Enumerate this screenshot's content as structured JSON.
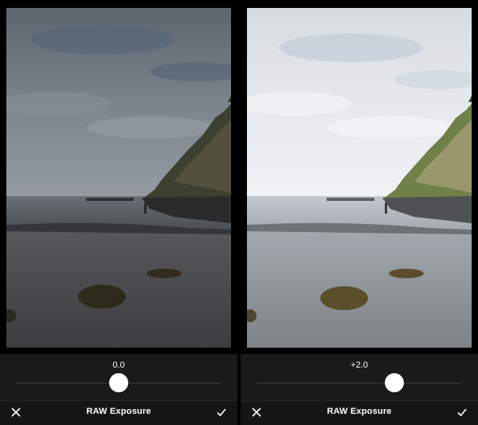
{
  "panels": [
    {
      "exposure_value": "0.0",
      "exposure_fraction": 0.5,
      "tool_title": "RAW Exposure",
      "cancel_icon": "close-icon",
      "confirm_icon": "checkmark-icon",
      "brightness": "dark"
    },
    {
      "exposure_value": "+2.0",
      "exposure_fraction": 0.67,
      "tool_title": "RAW Exposure",
      "cancel_icon": "close-icon",
      "confirm_icon": "checkmark-icon",
      "brightness": "bright"
    }
  ],
  "colors": {
    "background": "#000000",
    "control_bar": "#1a1a1a",
    "text": "#ffffff",
    "thumb": "#ffffff"
  }
}
